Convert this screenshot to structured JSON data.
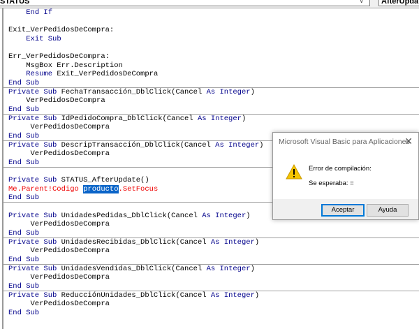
{
  "toolbar": {
    "object_combo": "STATUS",
    "procedure_combo": "AfterUpdate"
  },
  "code": [
    {
      "parts": [
        {
          "t": "    "
        },
        {
          "t": "End If",
          "c": "kw"
        }
      ]
    },
    {
      "parts": []
    },
    {
      "parts": [
        {
          "t": "Exit_VerPedidosDeCompra:"
        }
      ]
    },
    {
      "parts": [
        {
          "t": "    "
        },
        {
          "t": "Exit Sub",
          "c": "kw"
        }
      ]
    },
    {
      "parts": []
    },
    {
      "parts": [
        {
          "t": "Err_VerPedidosDeCompra:"
        }
      ]
    },
    {
      "parts": [
        {
          "t": "    MsgBox Err.Description"
        }
      ]
    },
    {
      "parts": [
        {
          "t": "    "
        },
        {
          "t": "Resume",
          "c": "kw"
        },
        {
          "t": " Exit_VerPedidosDeCompra"
        }
      ]
    },
    {
      "sep": true,
      "parts": [
        {
          "t": "End Sub",
          "c": "kw"
        }
      ]
    },
    {
      "parts": [
        {
          "t": "Private Sub",
          "c": "kw"
        },
        {
          "t": " FechaTransacción_DblClick(Cancel "
        },
        {
          "t": "As Integer",
          "c": "kw"
        },
        {
          "t": ")"
        }
      ]
    },
    {
      "parts": [
        {
          "t": "    VerPedidosDeCompra"
        }
      ]
    },
    {
      "sep": true,
      "parts": [
        {
          "t": "End Sub",
          "c": "kw"
        }
      ]
    },
    {
      "parts": [
        {
          "t": "Private Sub",
          "c": "kw"
        },
        {
          "t": " IdPedidoCompra_DblClick(Cancel "
        },
        {
          "t": "As Integer",
          "c": "kw"
        },
        {
          "t": ")"
        }
      ]
    },
    {
      "parts": [
        {
          "t": "     VerPedidosDeCompra"
        }
      ]
    },
    {
      "sep": true,
      "parts": [
        {
          "t": "End Sub",
          "c": "kw"
        }
      ]
    },
    {
      "parts": [
        {
          "t": "Private Sub",
          "c": "kw"
        },
        {
          "t": " DescripTransacción_DblClick(Cancel "
        },
        {
          "t": "As Integer",
          "c": "kw"
        },
        {
          "t": ")"
        }
      ]
    },
    {
      "parts": [
        {
          "t": "     VerPedidosDeCompra"
        }
      ]
    },
    {
      "sep": true,
      "parts": [
        {
          "t": "End Sub",
          "c": "kw"
        }
      ]
    },
    {
      "parts": []
    },
    {
      "parts": [
        {
          "t": "Private Sub",
          "c": "kw"
        },
        {
          "t": " STATUS_AfterUpdate()"
        }
      ]
    },
    {
      "parts": [
        {
          "t": "Me.Parent!Codigo ",
          "c": "err"
        },
        {
          "t": "producto",
          "c": "sel"
        },
        {
          "t": ".SetFocus",
          "c": "err"
        }
      ]
    },
    {
      "sep": true,
      "parts": [
        {
          "t": "End Sub",
          "c": "kw"
        }
      ]
    },
    {
      "parts": []
    },
    {
      "parts": [
        {
          "t": "Private Sub",
          "c": "kw"
        },
        {
          "t": " UnidadesPedidas_DblClick(Cancel "
        },
        {
          "t": "As Integer",
          "c": "kw"
        },
        {
          "t": ")"
        }
      ]
    },
    {
      "parts": [
        {
          "t": "     VerPedidosDeCompra"
        }
      ]
    },
    {
      "sep": true,
      "parts": [
        {
          "t": "End Sub",
          "c": "kw"
        }
      ]
    },
    {
      "parts": [
        {
          "t": "Private Sub",
          "c": "kw"
        },
        {
          "t": " UnidadesRecibidas_DblClick(Cancel "
        },
        {
          "t": "As Integer",
          "c": "kw"
        },
        {
          "t": ")"
        }
      ]
    },
    {
      "parts": [
        {
          "t": "     VerPedidosDeCompra"
        }
      ]
    },
    {
      "sep": true,
      "parts": [
        {
          "t": "End Sub",
          "c": "kw"
        }
      ]
    },
    {
      "parts": [
        {
          "t": "Private Sub",
          "c": "kw"
        },
        {
          "t": " UnidadesVendidas_DblClick(Cancel "
        },
        {
          "t": "As Integer",
          "c": "kw"
        },
        {
          "t": ")"
        }
      ]
    },
    {
      "parts": [
        {
          "t": "     VerPedidosDeCompra"
        }
      ]
    },
    {
      "sep": true,
      "parts": [
        {
          "t": "End Sub",
          "c": "kw"
        }
      ]
    },
    {
      "parts": [
        {
          "t": "Private Sub",
          "c": "kw"
        },
        {
          "t": " ReducciónUnidades_DblClick(Cancel "
        },
        {
          "t": "As Integer",
          "c": "kw"
        },
        {
          "t": ")"
        }
      ]
    },
    {
      "parts": [
        {
          "t": "     VerPedidosDeCompra"
        }
      ]
    },
    {
      "parts": [
        {
          "t": "End Sub",
          "c": "kw"
        }
      ]
    }
  ],
  "dialog": {
    "title": "Microsoft Visual Basic para Aplicaciones",
    "close": "✕",
    "message": "Error de compilación:",
    "detail": "Se esperaba: =",
    "ok_label": "Aceptar",
    "help_label": "Ayuda"
  }
}
